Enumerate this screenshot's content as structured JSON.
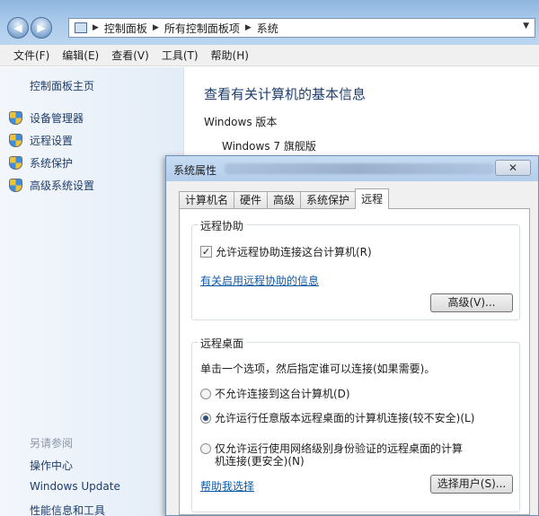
{
  "address_bar": {
    "crumbs": [
      "控制面板",
      "所有控制面板项",
      "系统"
    ]
  },
  "menubar": {
    "items": [
      "文件(F)",
      "编辑(E)",
      "查看(V)",
      "工具(T)",
      "帮助(H)"
    ]
  },
  "left_pane": {
    "home": "控制面板主页",
    "links": [
      "设备管理器",
      "远程设置",
      "系统保护",
      "高级系统设置"
    ],
    "see_also_title": "另请参阅",
    "see_also_links": [
      "操作中心",
      "Windows Update",
      "性能信息和工具"
    ]
  },
  "main": {
    "title": "查看有关计算机的基本信息",
    "section": "Windows 版本",
    "edition": "Windows 7 旗舰版"
  },
  "dialog": {
    "title": "系统属性",
    "close": "✕",
    "tabs": [
      "计算机名",
      "硬件",
      "高级",
      "系统保护",
      "远程"
    ],
    "active_tab": "远程",
    "remote_assistance": {
      "legend": "远程协助",
      "checkbox_label": "允许远程协助连接这台计算机(R)",
      "checked": true,
      "link": "有关启用远程协助的信息",
      "advanced_button": "高级(V)..."
    },
    "remote_desktop": {
      "legend": "远程桌面",
      "description": "单击一个选项，然后指定谁可以连接(如果需要)。",
      "options": [
        "不允许连接到这台计算机(D)",
        "允许运行任意版本远程桌面的计算机连接(较不安全)(L)",
        "仅允许运行使用网络级别身份验证的远程桌面的计算机连接(更安全)(N)"
      ],
      "selected_option": 1,
      "help_link": "帮助我选择",
      "select_users_button": "选择用户(S)..."
    }
  },
  "colors": {
    "link": "#0e5aa7",
    "nav_text": "#1e3d6b",
    "title_bar": "#a9c9ea"
  }
}
